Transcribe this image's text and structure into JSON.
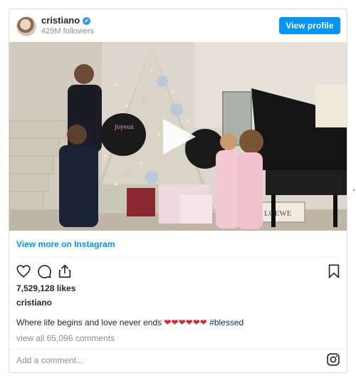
{
  "header": {
    "username": "cristiano",
    "verified_mark": "✔",
    "followers": "429M followers",
    "view_profile_label": "View profile"
  },
  "media": {
    "play_icon": "play-icon",
    "balloon_label": "Joyeux",
    "box_brand": "LOEWE"
  },
  "link": {
    "view_more": "View more on Instagram"
  },
  "actions": {
    "icons": [
      "heart-icon",
      "comment-icon",
      "share-icon",
      "bookmark-icon"
    ]
  },
  "post": {
    "likes": "7,529,128 likes",
    "author": "cristiano",
    "caption_text": "Where life begins and love never ends",
    "caption_hearts": "❤❤❤❤❤❤",
    "hashtag": "#blessed",
    "comments": "view all 65,096 comments"
  },
  "footer": {
    "add_comment_placeholder": "Add a comment...",
    "instagram_icon": "instagram-icon"
  },
  "colors": {
    "accent": "#0095f6",
    "heart": "#e0242b",
    "hashtag": "#00376b",
    "muted": "#8e8e8e"
  }
}
